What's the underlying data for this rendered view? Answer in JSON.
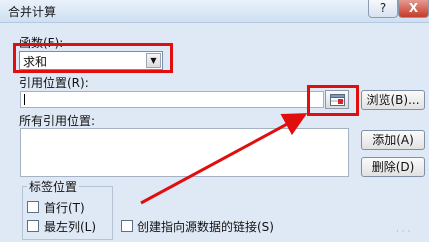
{
  "dialog": {
    "title": "合并计算",
    "help_label": "?",
    "close_label": "X"
  },
  "function_field": {
    "label": "函数(F):",
    "value": "求和"
  },
  "reference_field": {
    "label": "引用位置(R):",
    "value": ""
  },
  "buttons": {
    "browse": "浏览(B)...",
    "add": "添加(A)",
    "delete": "删除(D)"
  },
  "all_references": {
    "label": "所有引用位置:"
  },
  "label_position": {
    "title": "标签位置",
    "first_row": "首行(T)",
    "left_column": "最左列(L)"
  },
  "link_option": {
    "label": "创建指向源数据的链接(S)"
  },
  "colors": {
    "highlight": "#e10e0e",
    "dialog_bg": "#dfe9f5"
  }
}
